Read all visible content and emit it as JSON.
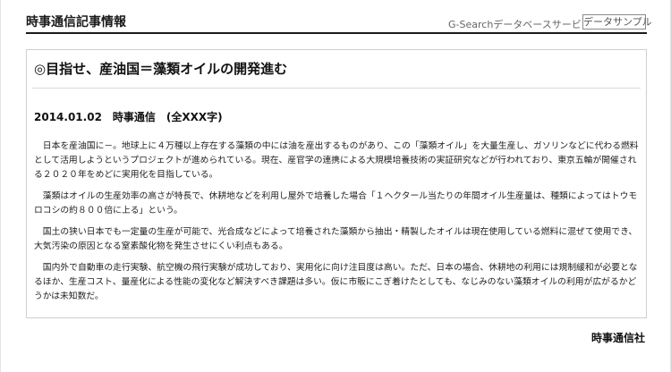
{
  "header": {
    "site_title": "時事通信記事情報",
    "service_name": "G-Searchデータベースサービス",
    "sample_button": "データサンプル"
  },
  "article": {
    "headline": "◎目指せ、産油国＝藻類オイルの開発進む",
    "dateline": "2014.01.02　時事通信　(全XXX字)",
    "paragraphs": [
      "日本を産油国に－。地球上に４万種以上存在する藻類の中には油を産出するものがあり、この「藻類オイル」を大量生産し、ガソリンなどに代わる燃料として活用しようというプロジェクトが進められている。現在、産官学の連携による大規模培養技術の実証研究などが行われており、東京五輪が開催される２０２０年をめどに実用化を目指している。",
      "藻類はオイルの生産効率の高さが特長で、休耕地などを利用し屋外で培養した場合「１ヘクタール当たりの年間オイル生産量は、種類によってはトウモロコシの約８００倍に上る」という。",
      "国土の狭い日本でも一定量の生産が可能で、光合成などによって培養された藻類から抽出・精製したオイルは現在使用している燃料に混ぜて使用でき、大気汚染の原因となる窒素酸化物を発生させにくい利点もある。",
      "国内外で自動車の走行実験、航空機の飛行実験が成功しており、実用化に向け注目度は高い。ただ、日本の場合、休耕地の利用には規制緩和が必要となるほか、生産コスト、量産化による性能の変化など解決すべき課題は多い。仮に市販にこぎ着けたとしても、なじみのない藻類オイルの利用が広がるかどうかは未知数だ。"
    ]
  },
  "footer": {
    "credit": "時事通信社"
  }
}
